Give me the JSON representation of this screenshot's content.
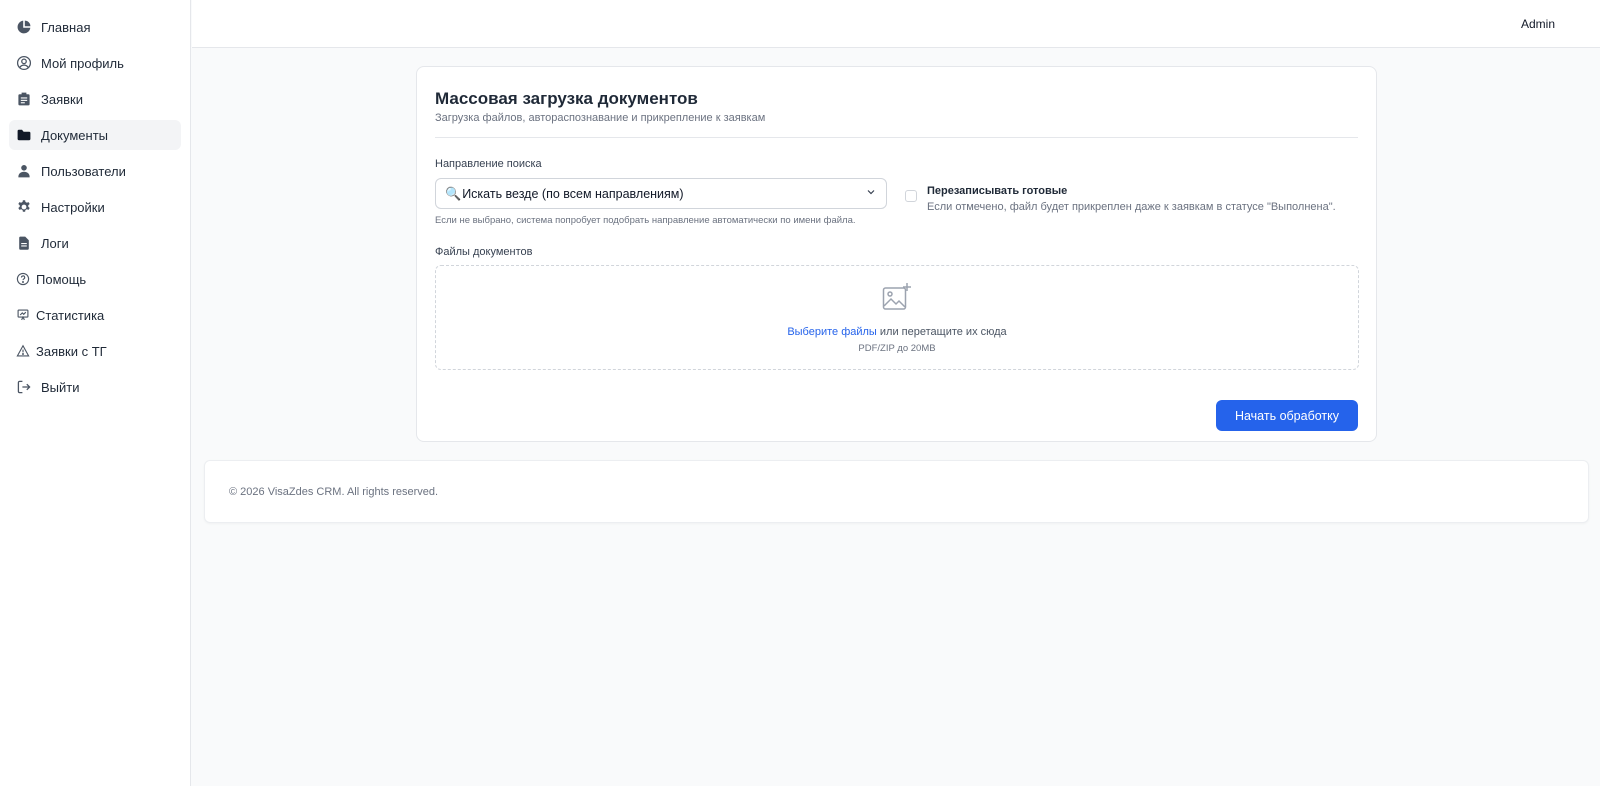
{
  "sidebar": {
    "items": [
      {
        "label": "Главная",
        "icon": "pie-chart-icon"
      },
      {
        "label": "Мой профиль",
        "icon": "user-circle-icon"
      },
      {
        "label": "Заявки",
        "icon": "clipboard-icon"
      },
      {
        "label": "Документы",
        "icon": "folder-icon",
        "active": true
      },
      {
        "label": "Пользователи",
        "icon": "user-icon"
      },
      {
        "label": "Настройки",
        "icon": "gear-icon"
      },
      {
        "label": "Логи",
        "icon": "document-icon"
      },
      {
        "label": "Помощь",
        "icon": "question-icon"
      },
      {
        "label": "Статистика",
        "icon": "presentation-chart-icon"
      },
      {
        "label": "Заявки с ТГ",
        "icon": "warning-triangle-icon"
      },
      {
        "label": "Выйти",
        "icon": "logout-icon"
      }
    ]
  },
  "header": {
    "user": "Admin"
  },
  "form": {
    "title": "Массовая загрузка документов",
    "subtitle": "Загрузка файлов, автораспознавание и прикрепление к заявкам",
    "direction_label": "Направление поиска",
    "direction_value": "Искать везде (по всем направлениям)",
    "direction_icon": "magnifier-emoji",
    "direction_hint": "Если не выбрано, система попробует подобрать направление автоматически по имени файла.",
    "overwrite_title": "Перезаписывать готовые",
    "overwrite_desc": "Если отмечено, файл будет прикреплен даже к заявкам в статусе \"Выполнена\".",
    "overwrite_checked": false,
    "files_label": "Файлы документов",
    "dropzone_link": "Выберите файлы",
    "dropzone_text": " или перетащите их сюда",
    "dropzone_hint": "PDF/ZIP до 20MB",
    "submit_label": "Начать обработку"
  },
  "footer": {
    "text": "© 2026 VisaZdes CRM. All rights reserved."
  },
  "colors": {
    "primary": "#2563eb",
    "background": "#f9fafb",
    "border": "#e5e7eb"
  }
}
